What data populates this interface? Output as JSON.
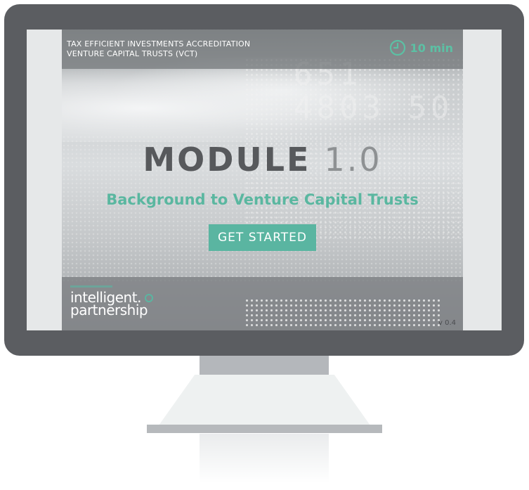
{
  "slide": {
    "header_line1": "TAX EFFICIENT INVESTMENTS ACCREDITATION",
    "header_line2": "VENTURE CAPITAL TRUSTS (VCT)",
    "timer_icon": "clock-icon",
    "timer_label": "10 min",
    "title_word": "MODULE",
    "title_number": "1.0",
    "subtitle": "Background to Venture Capital Trusts",
    "cta_label": "GET STARTED",
    "logo_line1": "intelligent.",
    "logo_line2": "partnership",
    "version": "v 0.4",
    "ticker_text": "651\n4803 50"
  },
  "colors": {
    "accent": "#5ab5a1",
    "title_dark": "#57595c",
    "title_light": "#8e9193",
    "monitor_frame": "#5b5d61"
  }
}
